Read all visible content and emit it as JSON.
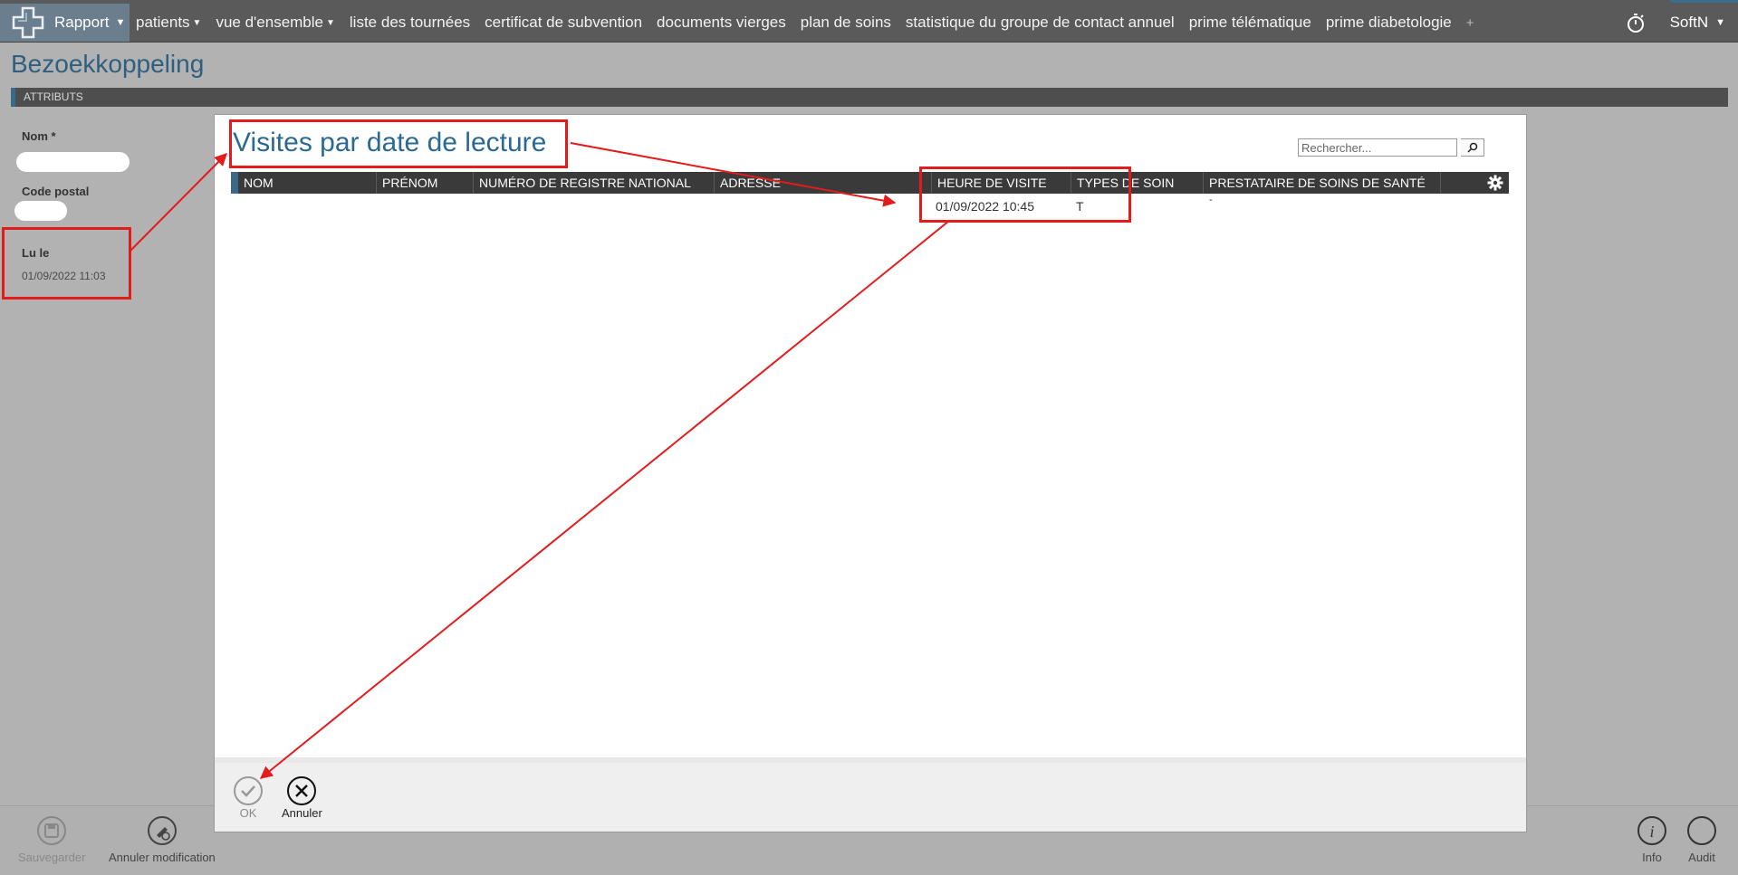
{
  "app": {
    "logo_icon": "medical-cross-icon",
    "menu_label": "Rapport",
    "nav_items": [
      {
        "label": "patients",
        "dropdown": true
      },
      {
        "label": "vue d'ensemble",
        "dropdown": true
      },
      {
        "label": "liste des tournées",
        "dropdown": false
      },
      {
        "label": "certificat de subvention",
        "dropdown": false
      },
      {
        "label": "documents vierges",
        "dropdown": false
      },
      {
        "label": "plan de soins",
        "dropdown": false
      },
      {
        "label": "statistique du groupe de contact annuel",
        "dropdown": false
      },
      {
        "label": "prime télématique",
        "dropdown": false
      },
      {
        "label": "prime diabetologie",
        "dropdown": false
      }
    ],
    "nav_add": "+",
    "user": "SoftN",
    "colors": {
      "nav_bg": "#5a5a5a",
      "accent": "#3a6a8a",
      "title": "#2a6a92",
      "annotation": "#e31b1b"
    }
  },
  "page": {
    "title": "Bezoekkoppeling",
    "section": "ATTRIBUTS",
    "fields": {
      "nom_label": "Nom *",
      "code_postal_label": "Code postal",
      "lu_le_label": "Lu le",
      "lu_le_value": "01/09/2022 11:03"
    }
  },
  "modal": {
    "title": "Visites par date de lecture",
    "search_placeholder": "Rechercher...",
    "columns": [
      "NOM",
      "PRÉNOM",
      "NUMÉRO DE REGISTRE NATIONAL",
      "ADRESSE",
      "HEURE DE VISITE",
      "TYPES DE SOIN",
      "PRESTATAIRE DE SOINS DE SANTÉ"
    ],
    "rows": [
      {
        "nom": "",
        "prenom": "",
        "registre": "",
        "adresse": "",
        "heure": "01/09/2022 10:45",
        "types": "T",
        "prestataire": "-"
      }
    ],
    "ok_label": "OK",
    "cancel_label": "Annuler"
  },
  "toolbar": {
    "save_label": "Sauvegarder",
    "undo_label": "Annuler modification",
    "info_label": "Info",
    "audit_label": "Audit"
  }
}
